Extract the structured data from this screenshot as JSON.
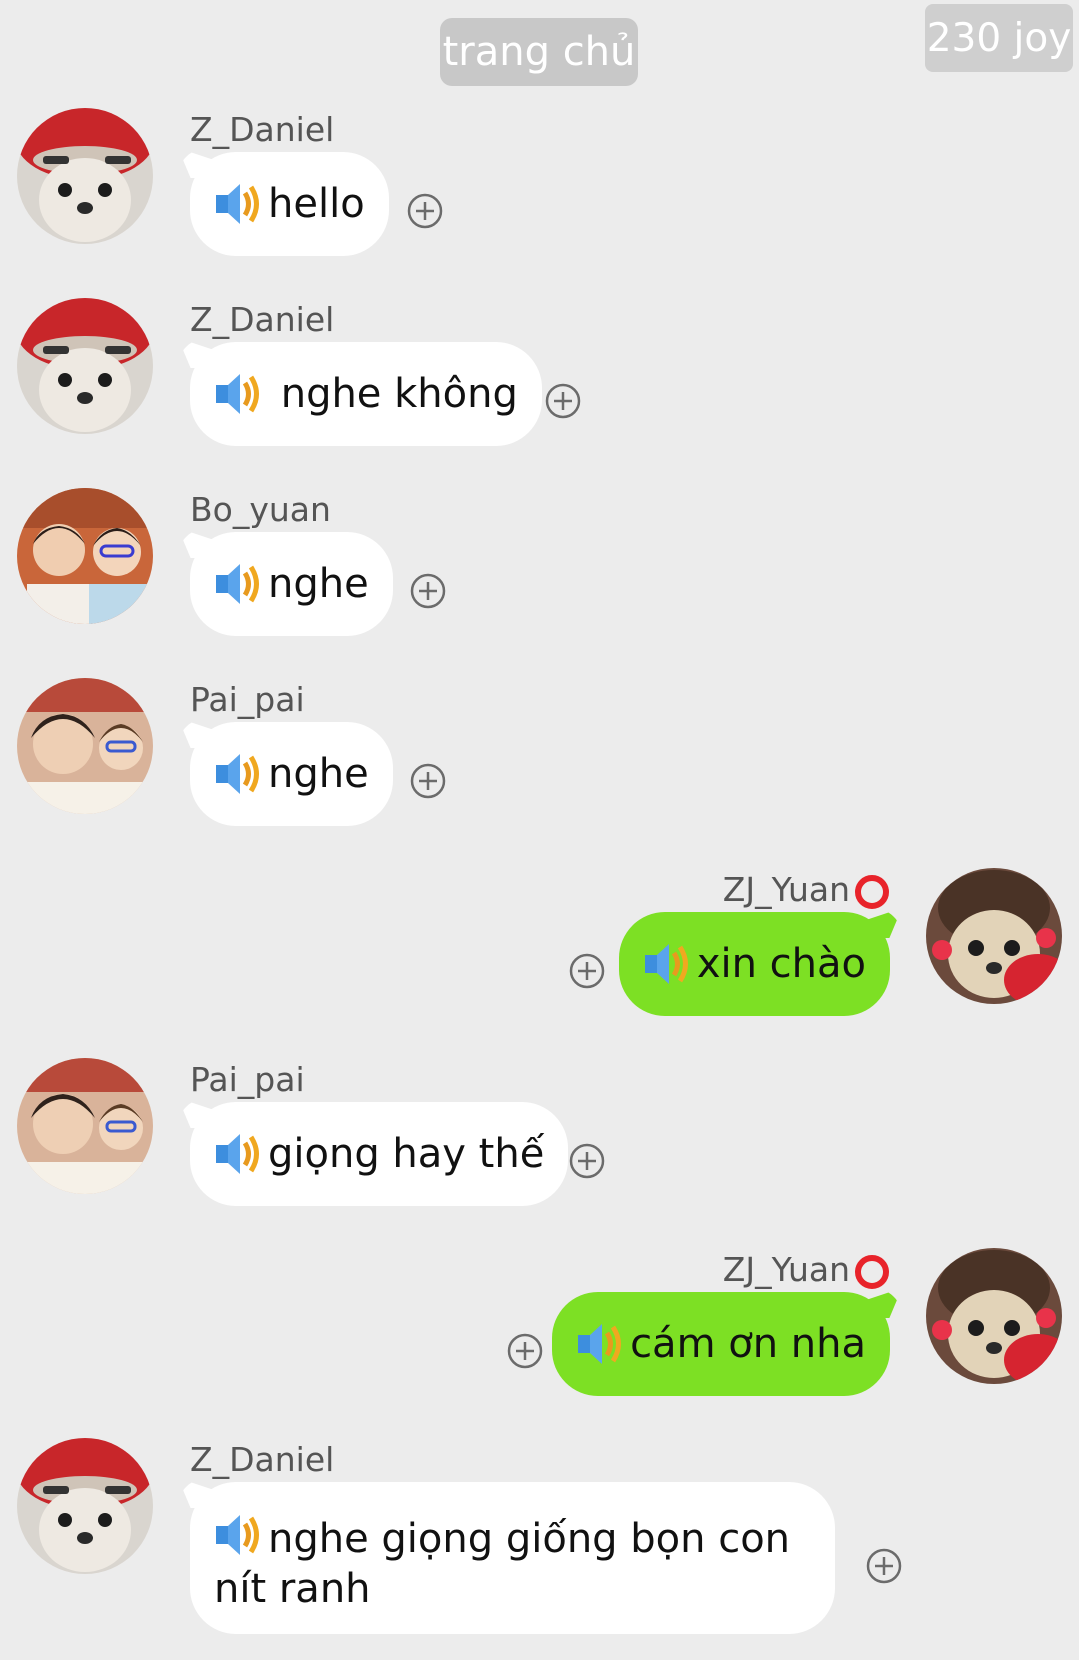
{
  "header": {
    "home_label": "trang chủ",
    "joy_label": "230 joy"
  },
  "messages": [
    {
      "sender": "Z_Daniel",
      "text": "hello",
      "side": "left",
      "avatar": "dog-red-hat-avatar"
    },
    {
      "sender": "Z_Daniel",
      "text": " nghe không",
      "side": "left",
      "avatar": "dog-red-hat-avatar"
    },
    {
      "sender": "Bo_yuan",
      "text": "nghe",
      "side": "left",
      "avatar": "two-boys-selfie-avatar"
    },
    {
      "sender": "Pai_pai",
      "text": "nghe",
      "side": "left",
      "avatar": "two-boys-avatar"
    },
    {
      "sender": "ZJ_Yuan",
      "text": "xin chào",
      "side": "right",
      "avatar": "dog-pigtails-avatar",
      "badge": "red-circle-icon"
    },
    {
      "sender": "Pai_pai",
      "text": "giọng hay thế",
      "side": "left",
      "avatar": "two-boys-avatar"
    },
    {
      "sender": "ZJ_Yuan",
      "text": "cám ơn nha",
      "side": "right",
      "avatar": "dog-pigtails-avatar",
      "badge": "red-circle-icon"
    },
    {
      "sender": "Z_Daniel",
      "text": "nghe giọng giống bọn con nít ranh",
      "side": "left",
      "avatar": "dog-red-hat-avatar"
    }
  ],
  "icons": {
    "voice": "speaker-icon",
    "add": "plus-circle-icon"
  },
  "colors": {
    "background": "#ececec",
    "own_bubble": "#7de024",
    "other_bubble": "#ffffff",
    "badge_ring": "#e8232a"
  }
}
